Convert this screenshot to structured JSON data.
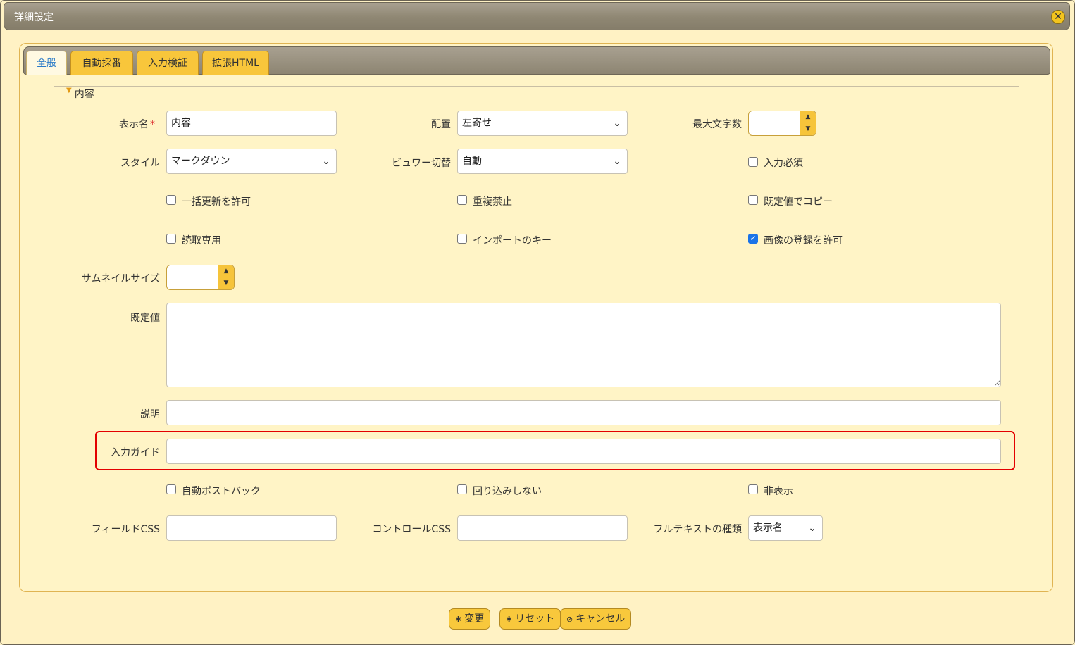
{
  "dialog": {
    "title": "詳細設定",
    "close_icon": "close-icon"
  },
  "tabs": [
    {
      "label": "全般",
      "active": true
    },
    {
      "label": "自動採番",
      "active": false
    },
    {
      "label": "入力検証",
      "active": false
    },
    {
      "label": "拡張HTML",
      "active": false
    }
  ],
  "section": {
    "legend": "内容"
  },
  "fields": {
    "display_name": {
      "label": "表示名",
      "required_mark": "*",
      "value": "内容"
    },
    "placement": {
      "label": "配置",
      "value": "左寄せ"
    },
    "max_chars": {
      "label": "最大文字数",
      "value": ""
    },
    "style": {
      "label": "スタイル",
      "value": "マークダウン"
    },
    "viewer_switch": {
      "label": "ビュワー切替",
      "value": "自動"
    },
    "required": {
      "label": "入力必須",
      "checked": false
    },
    "allow_bulk_update": {
      "label": "一括更新を許可",
      "checked": false
    },
    "no_duplicates": {
      "label": "重複禁止",
      "checked": false
    },
    "copy_default": {
      "label": "既定値でコピー",
      "checked": false
    },
    "read_only": {
      "label": "読取専用",
      "checked": false
    },
    "import_key": {
      "label": "インポートのキー",
      "checked": false
    },
    "allow_image": {
      "label": "画像の登録を許可",
      "checked": true
    },
    "thumbnail_size": {
      "label": "サムネイルサイズ",
      "value": ""
    },
    "default_value": {
      "label": "既定値",
      "value": ""
    },
    "description": {
      "label": "説明",
      "value": ""
    },
    "input_guide": {
      "label": "入力ガイド",
      "value": ""
    },
    "auto_postback": {
      "label": "自動ポストバック",
      "checked": false
    },
    "no_wrap": {
      "label": "回り込みしない",
      "checked": false
    },
    "hidden": {
      "label": "非表示",
      "checked": false
    },
    "field_css": {
      "label": "フィールドCSS",
      "value": ""
    },
    "control_css": {
      "label": "コントロールCSS",
      "value": ""
    },
    "fulltext_type": {
      "label": "フルテキストの種類",
      "value": "表示名"
    }
  },
  "actions": {
    "change": "変更",
    "reset": "リセット",
    "cancel": "キャンセル"
  },
  "colors": {
    "accent": "#f8c63b",
    "highlight": "#e30000",
    "titlebar": "#8f8773"
  }
}
